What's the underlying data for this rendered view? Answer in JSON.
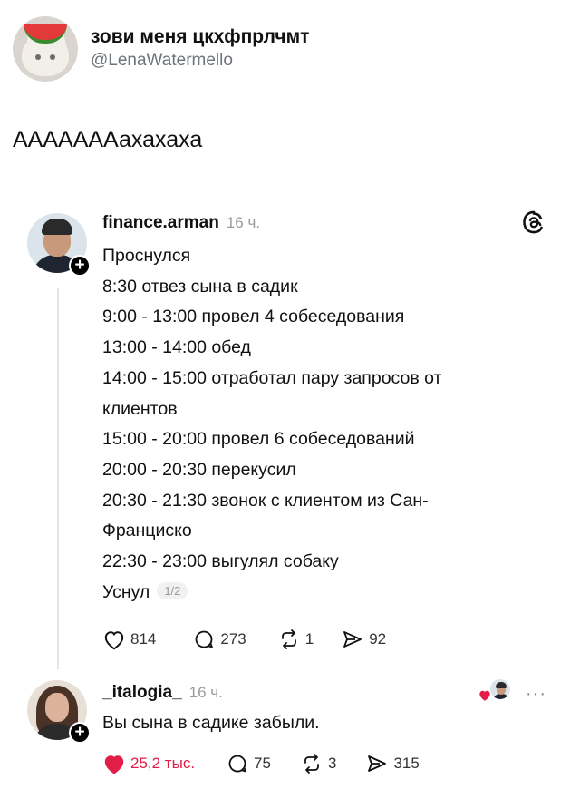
{
  "tweet": {
    "display_name": "зови меня цкхфпрлчмт",
    "handle": "@LenaWatermello",
    "text": "АААААААахахаха"
  },
  "post": {
    "username": "finance.arman",
    "time": "16 ч.",
    "lines": [
      "Проснулся",
      "8:30 отвез сына в садик",
      "9:00 - 13:00 провел 4 собеседования",
      "13:00 - 14:00 обед",
      "14:00 - 15:00 отработал пару запросов от",
      "клиентов",
      "15:00 - 20:00 провел 6 собеседований",
      "20:00 - 20:30 перекусил",
      "20:30 - 21:30 звонок с клиентом из Сан-",
      "Франциско",
      "22:30 - 23:00 выгулял собаку"
    ],
    "last_line": "Уснул",
    "page_indicator": "1/2",
    "likes": "814",
    "replies": "273",
    "reposts": "1",
    "shares": "92"
  },
  "reply": {
    "username": "_italogia_",
    "time": "16 ч.",
    "text": "Вы сына в садике забыли.",
    "likes": "25,2 тыс.",
    "replies": "75",
    "reposts": "3",
    "shares": "315",
    "more": "···"
  },
  "colors": {
    "like_red": "#e11d48",
    "muted": "#9a9a9a"
  },
  "icons": [
    "threads-logo-icon",
    "heart-icon",
    "comment-icon",
    "repost-icon",
    "share-icon",
    "plus-icon",
    "more-icon"
  ]
}
